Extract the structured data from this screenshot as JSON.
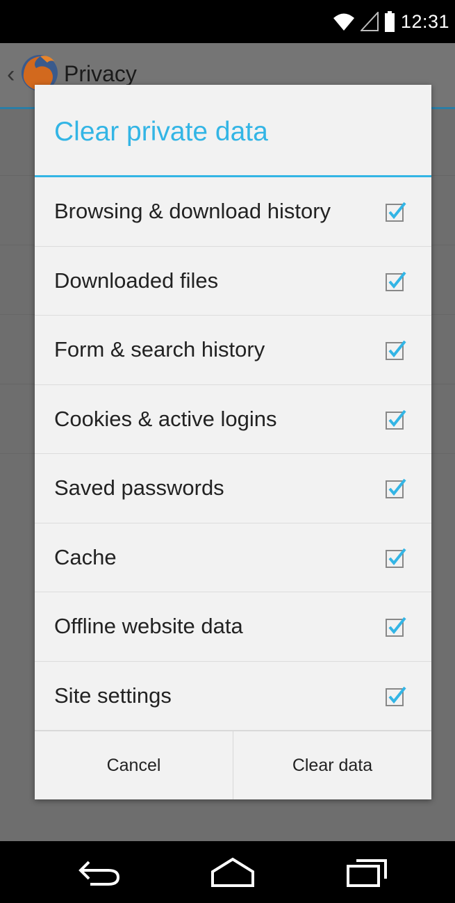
{
  "status_bar": {
    "time": "12:31",
    "icons": [
      "wifi-icon",
      "signal-icon",
      "battery-icon"
    ]
  },
  "app_bar": {
    "title": "Privacy",
    "back_icon": "chevron-left-icon",
    "logo_icon": "firefox-logo-icon"
  },
  "dialog": {
    "title": "Clear private data",
    "options": [
      {
        "label": "Browsing & download history",
        "checked": true
      },
      {
        "label": "Downloaded files",
        "checked": true
      },
      {
        "label": "Form & search history",
        "checked": true
      },
      {
        "label": "Cookies & active logins",
        "checked": true
      },
      {
        "label": "Saved passwords",
        "checked": true
      },
      {
        "label": "Cache",
        "checked": true
      },
      {
        "label": "Offline website data",
        "checked": true
      },
      {
        "label": "Site settings",
        "checked": true
      }
    ],
    "cancel_label": "Cancel",
    "confirm_label": "Clear data"
  },
  "nav_bar": {
    "icons": [
      "back-icon",
      "home-icon",
      "recent-apps-icon"
    ]
  },
  "colors": {
    "accent": "#33b5e5",
    "dim_background": "#6f6f6f"
  }
}
